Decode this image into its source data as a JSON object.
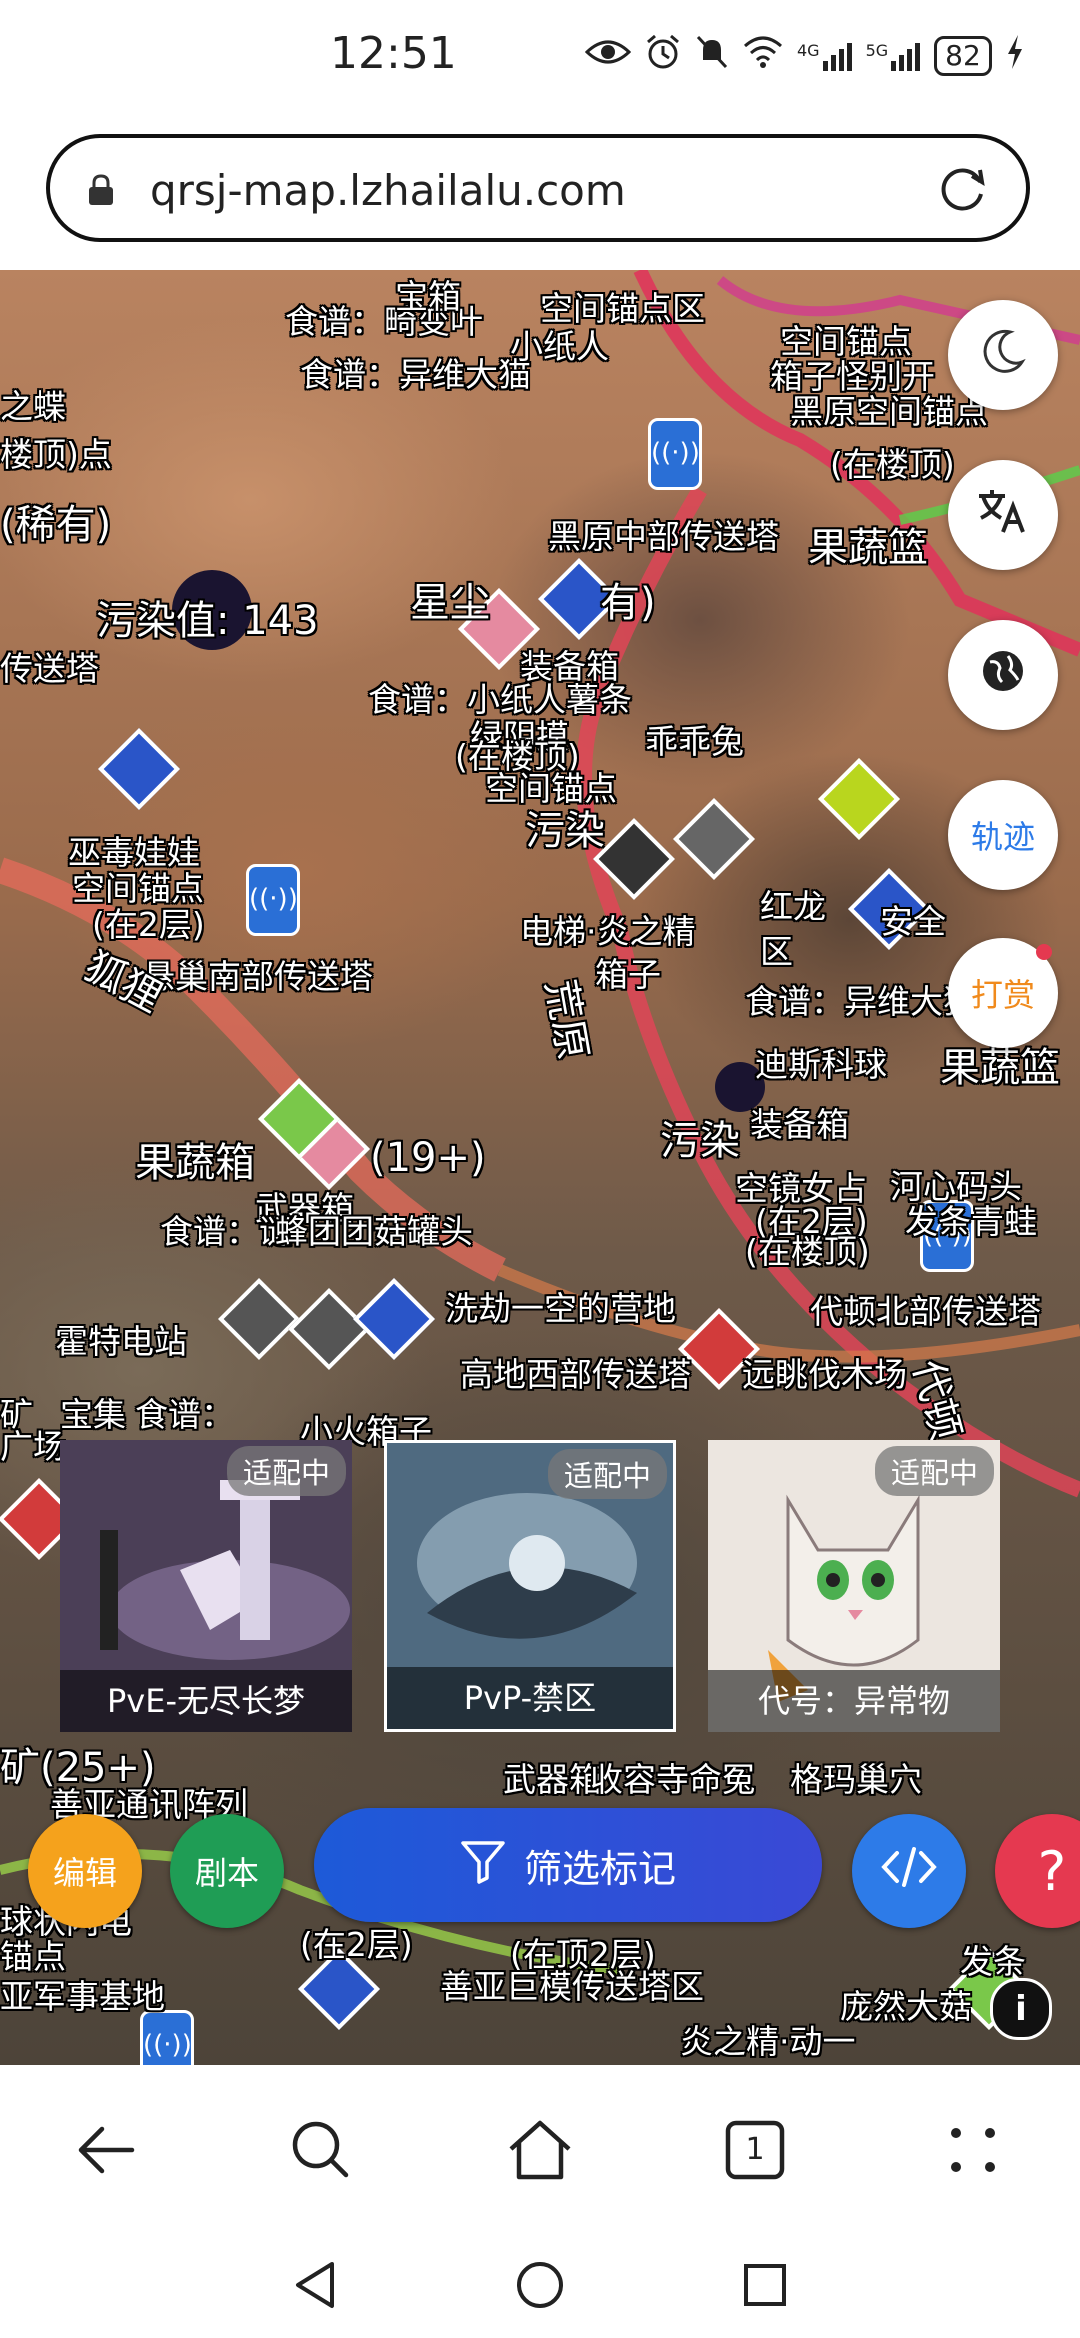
{
  "status_bar": {
    "time": "12:51",
    "network": "4G",
    "network2": "5G",
    "battery": "82"
  },
  "browser": {
    "url": "qrsj-map.lzhailalu.com",
    "tab_count": "1"
  },
  "map_labels": [
    "食谱：畸变叶",
    "宝箱",
    "空间锚点区",
    "食谱：异维大猫",
    "小纸人",
    "空间锚点",
    "箱子怪别开",
    "黑原空间锚点",
    "(在楼顶)",
    "之蝶",
    "楼顶)点",
    "(稀有)",
    "黑原中部传送塔",
    "果蔬篮",
    "污染值: 143",
    "星尘",
    "有)",
    "装备箱",
    "传送塔",
    "食谱：小纸人薯条",
    "绿阴摸",
    "(在楼顶)",
    "乖乖兔",
    "空间锚点",
    "污染",
    "巫毒娃娃",
    "空间锚点",
    "(在2层)",
    "电梯·炎之精",
    "红龙",
    "箱子",
    "安全",
    "区",
    "悬巢南部传送塔",
    "狐狸",
    "荒原",
    "食谱：异维大猫",
    "迪斯科球",
    "果蔬篮",
    "果蔬箱",
    "(19+)",
    "污染",
    "装备箱",
    "空镜女占",
    "河心码头",
    "武器箱",
    "食谱：谜",
    "蜂团团菇罐头",
    "(在2层)",
    "(在楼顶)",
    "发条青蛙",
    "霍特电站",
    "洗劫一空的营地",
    "代顿北部传送塔",
    "高地西部传送塔",
    "远眺伐木场",
    "代顿",
    "矿",
    "广场",
    "宝集",
    "食谱：",
    "小火箱子",
    "武器箱",
    "收容寺命冤",
    "格玛巢穴",
    "矿(25+)",
    "善亚通讯阵列",
    "(在2层)",
    "(在顶2层)",
    "善亚巨模传送塔区",
    "炎之精·动一",
    "庞然大菇",
    "亚军事基地",
    "发条",
    "球状闪电",
    "锚点"
  ],
  "side_buttons": {
    "night_mode_icon": "moon-icon",
    "translate_icon": "translate-icon",
    "globe_icon": "globe-icon",
    "track_label": "轨迹",
    "reward_label": "打赏"
  },
  "cards": [
    {
      "badge": "适配中",
      "title": "PvE-无尽长梦"
    },
    {
      "badge": "适配中",
      "title": "PvP-禁区"
    },
    {
      "badge": "适配中",
      "title": "代号：异常物"
    }
  ],
  "bottom_controls": {
    "edit_label": "编辑",
    "script_label": "剧本",
    "filter_label": "筛选标记",
    "code_icon": "code-icon",
    "help_label": "?",
    "info_label": "i"
  },
  "colors": {
    "edit": "#f5a21c",
    "script": "#1f9d55",
    "filter": "#1d5ad8",
    "code": "#2d7be8",
    "help": "#e53950",
    "track_text": "#2d7be8",
    "reward_text": "#f08a1c"
  }
}
